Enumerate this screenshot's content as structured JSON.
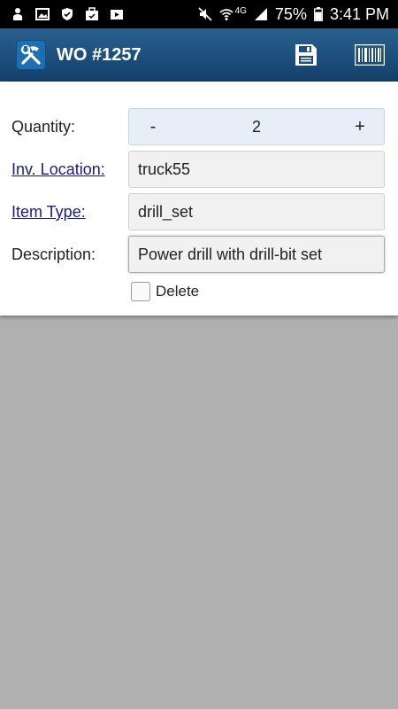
{
  "status_bar": {
    "battery": "75%",
    "time": "3:41 PM",
    "left_icons": [
      "person-icon",
      "image-icon",
      "shield-icon",
      "briefcase-icon",
      "play-icon"
    ],
    "right_icons": [
      "mute-icon",
      "wifi-icon",
      "signal-icon",
      "battery-icon"
    ],
    "network": "4G"
  },
  "header": {
    "title": "WO #1257",
    "logo_icon": "tools-icon",
    "save_icon": "save-icon",
    "barcode_icon": "barcode-icon",
    "colors": {
      "bar_top": "#2a6190",
      "bar_bottom": "#123f6a"
    }
  },
  "form": {
    "quantity": {
      "label": "Quantity:",
      "minus": "-",
      "value": "2",
      "plus": "+"
    },
    "inv_location": {
      "label": "Inv. Location:",
      "value": "truck55"
    },
    "item_type": {
      "label": "Item Type:",
      "value": "drill_set"
    },
    "description": {
      "label": "Description:",
      "value": "Power drill with drill-bit set"
    },
    "delete": {
      "label": "Delete",
      "checked": false
    }
  }
}
